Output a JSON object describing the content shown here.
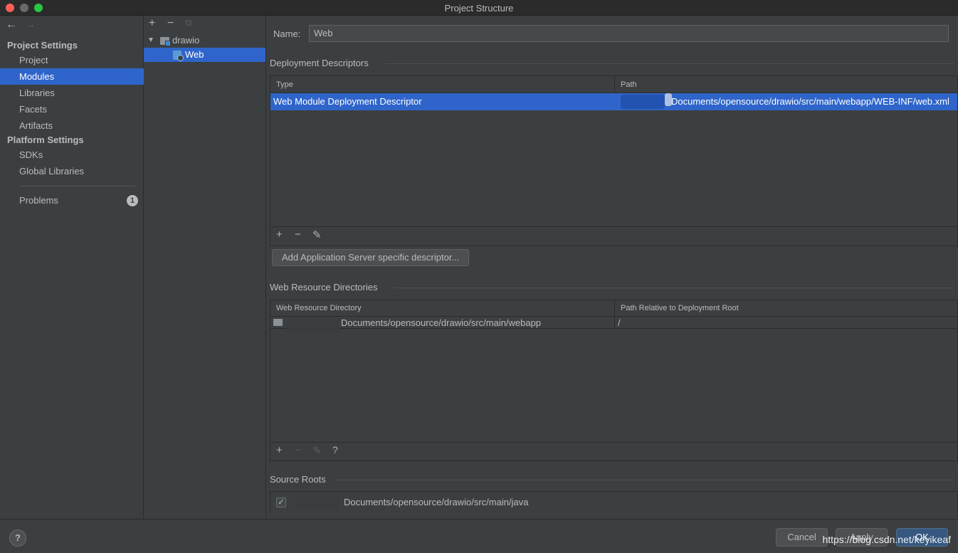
{
  "window": {
    "title": "Project Structure"
  },
  "nav": {
    "back_icon": "arrow-left-icon",
    "forward_icon": "arrow-right-icon",
    "project_settings_title": "Project Settings",
    "project_settings_items": [
      "Project",
      "Modules",
      "Libraries",
      "Facets",
      "Artifacts"
    ],
    "selected_item": "Modules",
    "platform_settings_title": "Platform Settings",
    "platform_settings_items": [
      "SDKs",
      "Global Libraries"
    ],
    "problems_label": "Problems",
    "problems_count": "1"
  },
  "module_tree": {
    "toolbar": {
      "add": "+",
      "remove": "−",
      "copy": "⧉"
    },
    "root": "drawio",
    "child": "Web"
  },
  "editor": {
    "name_label": "Name:",
    "name_value": "Web",
    "deployment": {
      "title": "Deployment Descriptors",
      "columns": [
        "Type",
        "Path"
      ],
      "rows": [
        {
          "type": "Web Module Deployment Descriptor",
          "path": "Documents/opensource/drawio/src/main/webapp/WEB-INF/web.xml"
        }
      ],
      "toolbar": {
        "add": "+",
        "remove": "−",
        "edit": "✎"
      },
      "add_server_button": "Add Application Server specific descriptor..."
    },
    "web_resources": {
      "title": "Web Resource Directories",
      "columns": [
        "Web Resource Directory",
        "Path Relative to Deployment Root"
      ],
      "rows": [
        {
          "directory": "Documents/opensource/drawio/src/main/webapp",
          "relative": "/"
        }
      ],
      "toolbar": {
        "add": "+",
        "remove": "−",
        "edit": "✎",
        "help": "?"
      }
    },
    "source_roots": {
      "title": "Source Roots",
      "items": [
        {
          "checked": true,
          "path": "Documents/opensource/drawio/src/main/java"
        }
      ]
    }
  },
  "footer": {
    "help": "?",
    "cancel": "Cancel",
    "apply": "Apply",
    "ok": "OK",
    "watermark": "https://blog.csdn.net/keyikeaf"
  }
}
